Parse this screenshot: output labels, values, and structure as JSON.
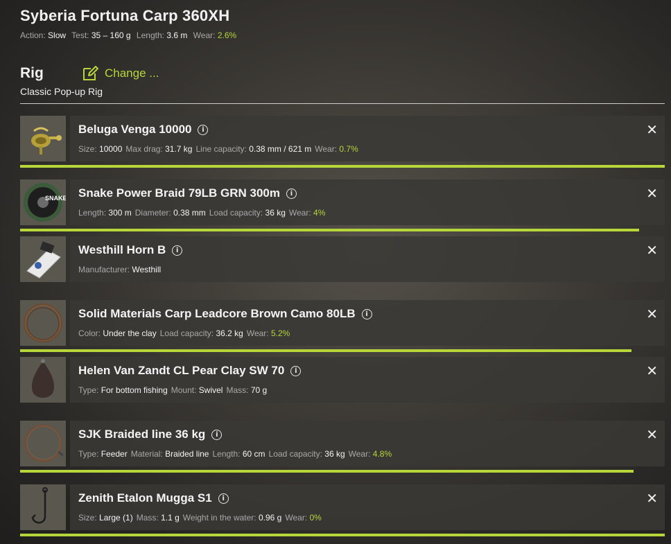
{
  "rod": {
    "title": "Syberia Fortuna Carp 360XH",
    "stats": [
      {
        "label": "Action:",
        "value": "Slow"
      },
      {
        "label": "Test:",
        "value": "35 – 160 g"
      },
      {
        "label": "Length:",
        "value": "3.6 m"
      },
      {
        "label": "Wear:",
        "value": "2.6%"
      }
    ]
  },
  "rig": {
    "title": "Rig",
    "change_label": "Change ...",
    "name": "Classic Pop-up Rig"
  },
  "colors": {
    "accent": "#b6d63a",
    "panel": "#3a3835"
  },
  "items": [
    {
      "name": "Beluga Venga 10000",
      "icon": "reel-icon",
      "details": [
        {
          "label": "Size:",
          "value": "10000"
        },
        {
          "label": "Max drag:",
          "value": "31.7 kg"
        },
        {
          "label": "Line capacity:",
          "value": "0.38 mm / 621 m"
        },
        {
          "label": "Wear:",
          "value": "0.7%"
        }
      ],
      "condition": 1.0
    },
    {
      "name": "Snake Power Braid 79LB GRN 300m",
      "icon": "line-spool-icon",
      "details": [
        {
          "label": "Length:",
          "value": "300 m"
        },
        {
          "label": "Diameter:",
          "value": "0.38 mm"
        },
        {
          "label": "Load capacity:",
          "value": "36 kg"
        },
        {
          "label": "Wear:",
          "value": "4%"
        }
      ],
      "condition": 0.96
    },
    {
      "name": "Westhill Horn B",
      "icon": "bite-alarm-icon",
      "details": [
        {
          "label": "Manufacturer:",
          "value": "Westhill"
        }
      ],
      "condition": null
    },
    {
      "name": "Solid Materials Carp Leadcore Brown Camo 80LB",
      "icon": "leadcore-coil-icon",
      "details": [
        {
          "label": "Color:",
          "value": "Under the clay"
        },
        {
          "label": "Load capacity:",
          "value": "36.2 kg"
        },
        {
          "label": "Wear:",
          "value": "5.2%"
        }
      ],
      "condition": 0.948
    },
    {
      "name": "Helen Van Zandt CL Pear Clay SW 70",
      "icon": "sinker-icon",
      "details": [
        {
          "label": "Type:",
          "value": "For bottom fishing"
        },
        {
          "label": "Mount:",
          "value": "Swivel"
        },
        {
          "label": "Mass:",
          "value": "70 g"
        }
      ],
      "condition": null
    },
    {
      "name": "SJK Braided line 36 kg",
      "icon": "braided-leader-icon",
      "details": [
        {
          "label": "Type:",
          "value": "Feeder"
        },
        {
          "label": "Material:",
          "value": "Braided line"
        },
        {
          "label": "Length:",
          "value": "60 cm"
        },
        {
          "label": "Load capacity:",
          "value": "36 kg"
        },
        {
          "label": "Wear:",
          "value": "4.8%"
        }
      ],
      "condition": 0.952
    },
    {
      "name": "Zenith Etalon Mugga S1",
      "icon": "hook-icon",
      "details": [
        {
          "label": "Size:",
          "value": "Large (1)"
        },
        {
          "label": "Mass:",
          "value": "1.1 g"
        },
        {
          "label": "Weight in the water:",
          "value": "0.96 g"
        },
        {
          "label": "Wear:",
          "value": "0%"
        }
      ],
      "condition": 1.0
    }
  ]
}
